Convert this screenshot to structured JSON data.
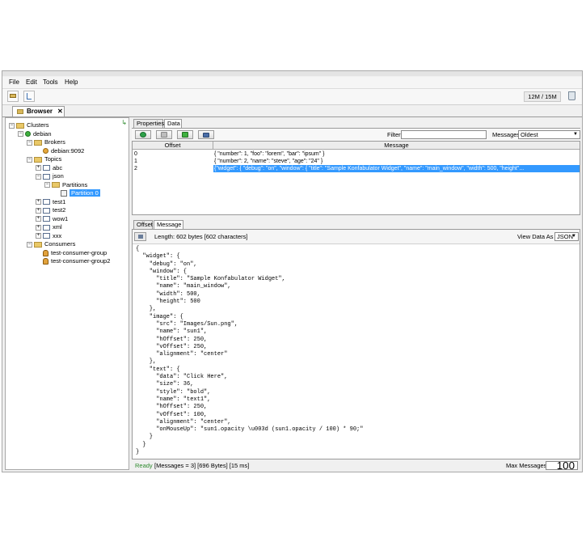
{
  "menu": [
    "File",
    "Edit",
    "Tools",
    "Help"
  ],
  "toolbar": {
    "memory": "12M / 15M"
  },
  "main_tab": {
    "label": "Browser",
    "close": "✕"
  },
  "tree": [
    {
      "label": "Clusters",
      "icon": "folder-icon",
      "level": 0,
      "toggle": "−"
    },
    {
      "label": "debian",
      "icon": "cluster-status-icon",
      "level": 1,
      "toggle": "−"
    },
    {
      "label": "Brokers",
      "icon": "folder-icon",
      "level": 2,
      "toggle": "−"
    },
    {
      "label": "debian:9092",
      "icon": "broker-icon",
      "level": 3,
      "toggle": ""
    },
    {
      "label": "Topics",
      "icon": "folder-icon",
      "level": 2,
      "toggle": "−"
    },
    {
      "label": "abc",
      "icon": "topic-icon",
      "level": 3,
      "toggle": "+"
    },
    {
      "label": "json",
      "icon": "topic-icon",
      "level": 3,
      "toggle": "−"
    },
    {
      "label": "Partitions",
      "icon": "folder-icon",
      "level": 4,
      "toggle": "−"
    },
    {
      "label": "Partition 0",
      "icon": "partition-icon",
      "level": 5,
      "toggle": "",
      "selected": true
    },
    {
      "label": "test1",
      "icon": "topic-icon",
      "level": 3,
      "toggle": "+"
    },
    {
      "label": "test2",
      "icon": "topic-icon",
      "level": 3,
      "toggle": "+"
    },
    {
      "label": "wow1",
      "icon": "topic-icon",
      "level": 3,
      "toggle": "+"
    },
    {
      "label": "xml",
      "icon": "topic-icon",
      "level": 3,
      "toggle": "+"
    },
    {
      "label": "xxx",
      "icon": "topic-icon",
      "level": 3,
      "toggle": "+"
    },
    {
      "label": "Consumers",
      "icon": "folder-icon",
      "level": 2,
      "toggle": "−"
    },
    {
      "label": "test-consumer-group",
      "icon": "consumer-icon",
      "level": 3,
      "toggle": ""
    },
    {
      "label": "test-consumer-group2",
      "icon": "consumer-icon",
      "level": 3,
      "toggle": ""
    }
  ],
  "top_tabs": [
    "Properties",
    "Data"
  ],
  "filter": {
    "label": "Filter",
    "value": ""
  },
  "messages_select": {
    "label": "Messages",
    "value": "Oldest"
  },
  "grid": {
    "columns": [
      "Offset",
      "Message"
    ],
    "rows": [
      {
        "offset": "0",
        "message": "{ \"number\": 1, \"foo\": \"lorem\", \"bar\": \"ipsum\" }"
      },
      {
        "offset": "1",
        "message": "{ \"number\": 2, \"name\": \"steve\", \"age\": \"24\" }"
      },
      {
        "offset": "2",
        "message": "{\"widget\": {     \"debug\": \"on\",     \"window\": {         \"title\": \"Sample Konfabulator Widget\",         \"name\": \"main_window\",         \"width\": 500,         \"height\"...",
        "selected": true
      }
    ]
  },
  "bottom_tabs": [
    "Offset",
    "Message"
  ],
  "message_info": {
    "length": "Length: 602 bytes [602 characters]",
    "view_label": "View Data As",
    "view_value": "JSON"
  },
  "message_body": "{\n  \"widget\": {\n    \"debug\": \"on\",\n    \"window\": {\n      \"title\": \"Sample Konfabulator Widget\",\n      \"name\": \"main_window\",\n      \"width\": 500,\n      \"height\": 500\n    },\n    \"image\": {\n      \"src\": \"Images/Sun.png\",\n      \"name\": \"sun1\",\n      \"hOffset\": 250,\n      \"vOffset\": 250,\n      \"alignment\": \"center\"\n    },\n    \"text\": {\n      \"data\": \"Click Here\",\n      \"size\": 36,\n      \"style\": \"bold\",\n      \"name\": \"text1\",\n      \"hOffset\": 250,\n      \"vOffset\": 100,\n      \"alignment\": \"center\",\n      \"onMouseUp\": \"sun1.opacity \\u003d (sun1.opacity / 100) * 90;\"\n    }\n  }\n}",
  "status": {
    "ready": "Ready",
    "stats": "[Messages = 3]  [696 Bytes]  [15 ms]",
    "max_label": "Max Messages",
    "max_value": "100"
  },
  "colors": {
    "selection": "#3399ff",
    "ready": "#2e8b2e"
  }
}
